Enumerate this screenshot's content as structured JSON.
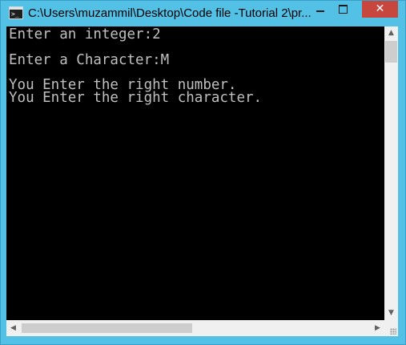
{
  "window": {
    "title": "C:\\Users\\muzammil\\Desktop\\Code file -Tutorial 2\\pr...",
    "icon": "console-app-icon",
    "controls": {
      "minimize_icon": "minimize-icon",
      "maximize_icon": "maximize-icon",
      "close_glyph": "✕"
    }
  },
  "console": {
    "lines": [
      "Enter an integer:2",
      "",
      "Enter a Character:M",
      "",
      "You Enter the right number.",
      "You Enter the right character."
    ],
    "text_color": "#c0c0c0",
    "background": "#000000"
  },
  "scrollbars": {
    "up_arrow": "▲",
    "down_arrow": "▼",
    "left_arrow": "◀",
    "right_arrow": "▶"
  },
  "colors": {
    "frame": "#53c0e6",
    "close_button": "#c7463d"
  }
}
